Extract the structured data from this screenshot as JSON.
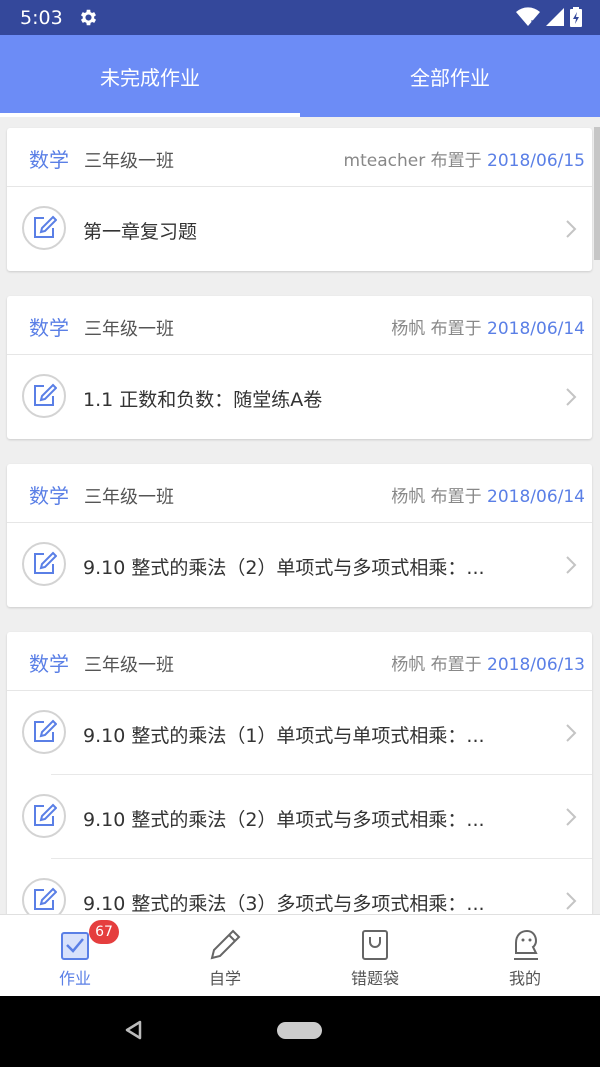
{
  "status_bar": {
    "time": "5:03"
  },
  "tabs": [
    {
      "label": "未完成作业",
      "active": true
    },
    {
      "label": "全部作业",
      "active": false
    }
  ],
  "cards": [
    {
      "subject": "数学",
      "class": "三年级一班",
      "teacher": "mteacher",
      "assigned_label": "布置于",
      "date": "2018/06/15",
      "items": [
        {
          "title": "第一章复习题"
        }
      ]
    },
    {
      "subject": "数学",
      "class": "三年级一班",
      "teacher": "杨帆",
      "assigned_label": "布置于",
      "date": "2018/06/14",
      "items": [
        {
          "title": "1.1 正数和负数：随堂练A卷"
        }
      ]
    },
    {
      "subject": "数学",
      "class": "三年级一班",
      "teacher": "杨帆",
      "assigned_label": "布置于",
      "date": "2018/06/14",
      "items": [
        {
          "title": "9.10 整式的乘法（2）单项式与多项式相乘：..."
        }
      ]
    },
    {
      "subject": "数学",
      "class": "三年级一班",
      "teacher": "杨帆",
      "assigned_label": "布置于",
      "date": "2018/06/13",
      "items": [
        {
          "title": "9.10 整式的乘法（1）单项式与单项式相乘：..."
        },
        {
          "title": "9.10 整式的乘法（2）单项式与多项式相乘：..."
        },
        {
          "title": "9.10 整式的乘法（3）多项式与多项式相乘：..."
        }
      ]
    }
  ],
  "bottom_nav": [
    {
      "label": "作业",
      "icon": "homework-icon",
      "active": true,
      "badge": "67"
    },
    {
      "label": "自学",
      "icon": "pencil-icon",
      "active": false
    },
    {
      "label": "错题袋",
      "icon": "bag-icon",
      "active": false
    },
    {
      "label": "我的",
      "icon": "profile-icon",
      "active": false
    }
  ],
  "colors": {
    "status_bar": "#34489b",
    "header": "#6c8cf6",
    "accent": "#5a7fe6",
    "badge": "#e53e3e"
  }
}
